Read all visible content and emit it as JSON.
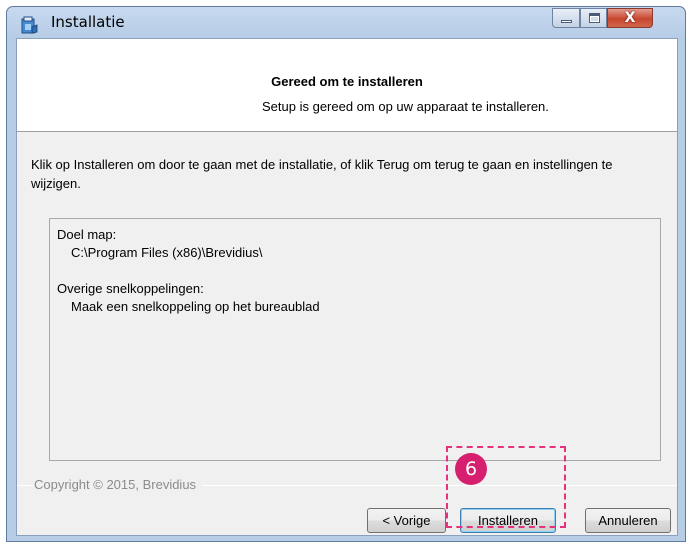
{
  "window": {
    "title": "Installatie",
    "controls": [
      "minimize-icon",
      "maximize-icon",
      "close-icon"
    ],
    "close_glyph": "X"
  },
  "header": {
    "title": "Gereed om te installeren",
    "subtitle": "Setup is gereed om op uw apparaat te installeren."
  },
  "instruction": "Klik op Installeren om door te gaan met de installatie, of klik Terug om terug te gaan en instellingen te wijzigen.",
  "summary": {
    "dest_label": "Doel map:",
    "dest_value": "C:\\Program Files (x86)\\Brevidius\\",
    "shortcuts_label": "Overige snelkoppelingen:",
    "shortcuts_value": "Maak een snelkoppeling op het bureaublad"
  },
  "footer": {
    "copyright": "Copyright © 2015, Brevidius"
  },
  "buttons": {
    "back": "< Vorige",
    "install": "Installeren",
    "cancel": "Annuleren"
  },
  "annotation": {
    "step": "6",
    "color": "#d6206f"
  }
}
